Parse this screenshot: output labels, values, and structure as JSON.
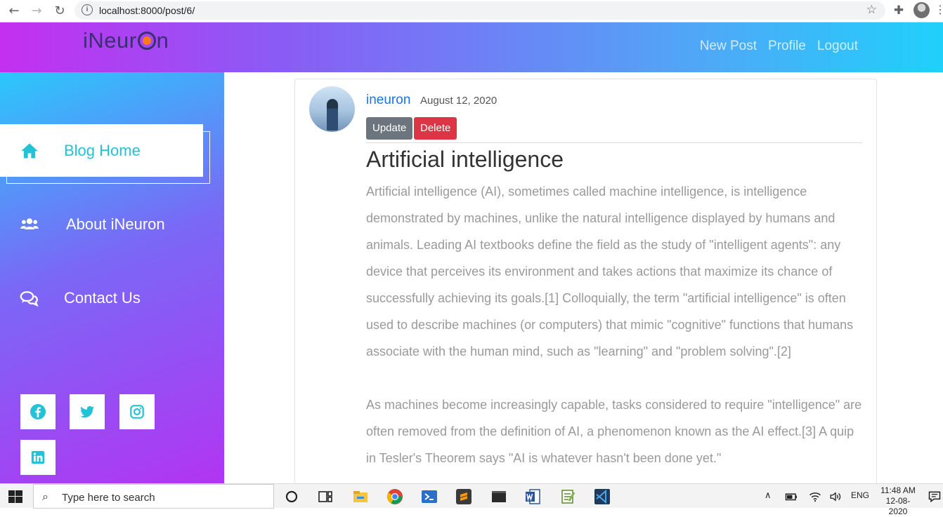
{
  "browser": {
    "url": "localhost:8000/post/6/",
    "back_glyph": "←",
    "forward_glyph": "→",
    "reload_glyph": "↻",
    "info_glyph": "i",
    "star_glyph": "☆",
    "ext_glyph": "✚",
    "menu_glyph": "⋮"
  },
  "navbar": {
    "brand_left": "iNeur",
    "brand_right": "n",
    "links": [
      "New Post",
      "Profile",
      "Logout"
    ]
  },
  "sidebar": {
    "items": [
      {
        "label": "Blog Home",
        "icon": "home-icon"
      },
      {
        "label": "About iNeuron",
        "icon": "users-icon"
      },
      {
        "label": "Contact Us",
        "icon": "comments-icon"
      }
    ],
    "social": [
      "facebook-icon",
      "twitter-icon",
      "instagram-icon",
      "linkedin-icon"
    ]
  },
  "post": {
    "author": "ineuron",
    "date": "August 12, 2020",
    "update_label": "Update",
    "delete_label": "Delete",
    "title": "Artificial intelligence",
    "paragraphs": [
      "Artificial intelligence (AI), sometimes called machine intelligence, is intelligence demonstrated by machines, unlike the natural intelligence displayed by humans and animals. Leading AI textbooks define the field as the study of \"intelligent agents\": any device that perceives its environment and takes actions that maximize its chance of successfully achieving its goals.[1] Colloquially, the term \"artificial intelligence\" is often used to describe machines (or computers) that mimic \"cognitive\" functions that humans associate with the human mind, such as \"learning\" and \"problem solving\".[2]",
      "As machines become increasingly capable, tasks considered to require \"intelligence\" are often removed from the definition of AI, a phenomenon known as the AI effect.[3] A quip in Tesler's Theorem says \"AI is whatever hasn't been done yet.\""
    ]
  },
  "taskbar": {
    "search_placeholder": "Type here to search",
    "search_glyph": "⌕",
    "tray_chevron": "∧",
    "language": "ENG",
    "time": "11:48 AM",
    "date": "12-08-2020"
  },
  "colors": {
    "accent": "#22c3d6",
    "delete": "#dc3545",
    "update": "#6c757d",
    "link": "#1a73e8"
  }
}
